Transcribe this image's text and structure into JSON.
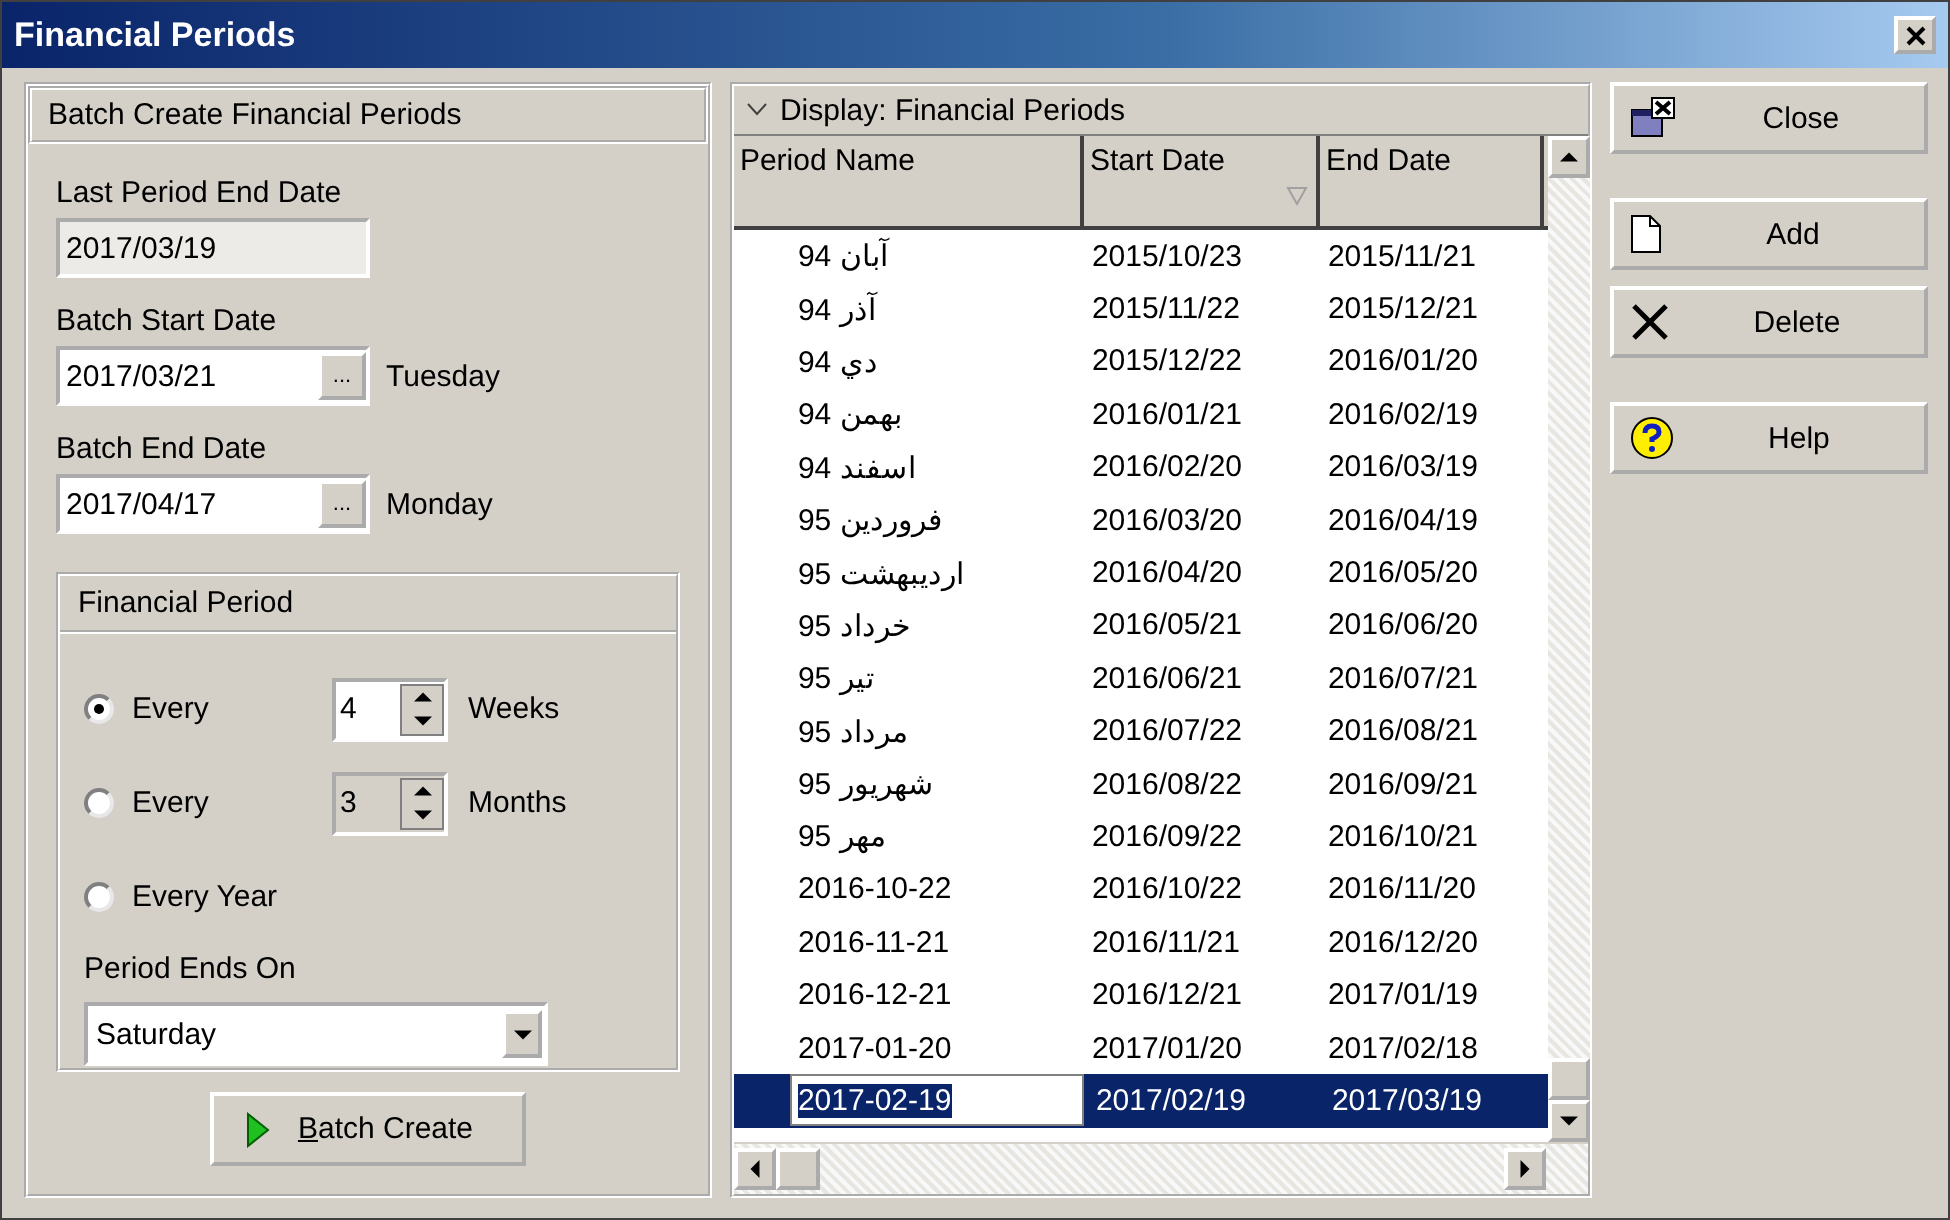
{
  "window": {
    "title": "Financial Periods"
  },
  "batch": {
    "title": "Batch Create Financial Periods",
    "last_end": {
      "label": "Last Period End Date",
      "value": "2017/03/19",
      "disabled": true
    },
    "dates": [
      {
        "label": "Batch Start Date",
        "value": "2017/03/21",
        "button": "...",
        "day": "Tuesday"
      },
      {
        "label": "Batch End Date",
        "value": "2017/04/17",
        "button": "...",
        "day": "Monday"
      }
    ],
    "period": {
      "title": "Financial Period",
      "options": [
        {
          "label": "Every",
          "selected": true,
          "spinner": {
            "value": "4",
            "unit": "Weeks",
            "disabled": false
          }
        },
        {
          "label": "Every",
          "selected": false,
          "spinner": {
            "value": "3",
            "unit": "Months",
            "disabled": true
          }
        },
        {
          "label": "Every Year",
          "selected": false
        }
      ],
      "ends_on": {
        "label": "Period Ends On",
        "value": "Saturday"
      }
    },
    "create_button": "Batch Create"
  },
  "grid": {
    "title": "Display: Financial Periods",
    "expanded": true,
    "columns": [
      {
        "label": "Period Name",
        "sorted": false
      },
      {
        "label": "Start Date",
        "sorted": true
      },
      {
        "label": "End Date",
        "sorted": false
      }
    ],
    "rows": [
      {
        "cells": [
          "آبان 94",
          "2015/10/23",
          "2015/11/21"
        ],
        "selected": false
      },
      {
        "cells": [
          "آذر 94",
          "2015/11/22",
          "2015/12/21"
        ],
        "selected": false
      },
      {
        "cells": [
          "دي 94",
          "2015/12/22",
          "2016/01/20"
        ],
        "selected": false
      },
      {
        "cells": [
          "بهمن 94",
          "2016/01/21",
          "2016/02/19"
        ],
        "selected": false
      },
      {
        "cells": [
          "اسفند 94",
          "2016/02/20",
          "2016/03/19"
        ],
        "selected": false
      },
      {
        "cells": [
          "فروردين 95",
          "2016/03/20",
          "2016/04/19"
        ],
        "selected": false
      },
      {
        "cells": [
          "ارديبهشت 95",
          "2016/04/20",
          "2016/05/20"
        ],
        "selected": false
      },
      {
        "cells": [
          "خرداد 95",
          "2016/05/21",
          "2016/06/20"
        ],
        "selected": false
      },
      {
        "cells": [
          "تير 95",
          "2016/06/21",
          "2016/07/21"
        ],
        "selected": false
      },
      {
        "cells": [
          "مرداد 95",
          "2016/07/22",
          "2016/08/21"
        ],
        "selected": false
      },
      {
        "cells": [
          "شهريور 95",
          "2016/08/22",
          "2016/09/21"
        ],
        "selected": false
      },
      {
        "cells": [
          "مهر 95",
          "2016/09/22",
          "2016/10/21"
        ],
        "selected": false
      },
      {
        "cells": [
          "2016-10-22",
          "2016/10/22",
          "2016/11/20"
        ],
        "selected": false
      },
      {
        "cells": [
          "2016-11-21",
          "2016/11/21",
          "2016/12/20"
        ],
        "selected": false
      },
      {
        "cells": [
          "2016-12-21",
          "2016/12/21",
          "2017/01/19"
        ],
        "selected": false
      },
      {
        "cells": [
          "2017-01-20",
          "2017/01/20",
          "2017/02/18"
        ],
        "selected": false
      },
      {
        "cells": [
          "2017-02-19",
          "2017/02/19",
          "2017/03/19"
        ],
        "selected": true
      }
    ]
  },
  "actions": [
    {
      "label": "Close",
      "kind": "close"
    },
    {
      "label": "Add",
      "kind": "add"
    },
    {
      "label": "Delete",
      "kind": "delete"
    },
    {
      "label": "Help",
      "kind": "help"
    }
  ]
}
